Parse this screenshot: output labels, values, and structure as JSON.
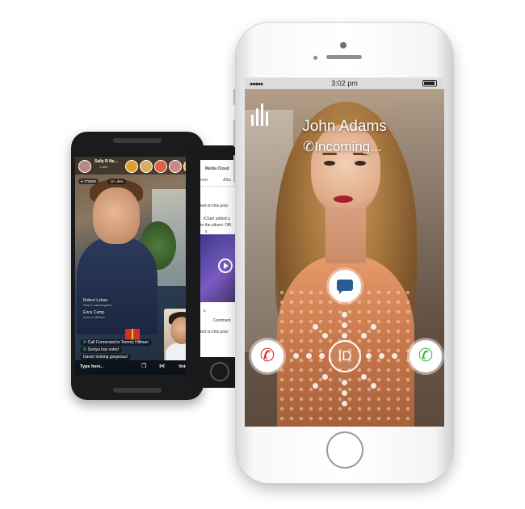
{
  "android": {
    "header_name": "Sally R Ne...",
    "header_sub": "1,080",
    "viewers": "778000",
    "badge": "12 Likes",
    "caption1_name": "Robert Leban",
    "caption1_sub": "Sent a Lamborghini",
    "caption2_name": "Erica Camp",
    "caption2_sub": "Sent a Gift Box",
    "chat1": "Call Connected to Tommy Hillman",
    "chat2": "Soniya has voted",
    "chat3": "David: looking gorgeous!",
    "input_placeholder": "Type here..",
    "vote_label": "Vote",
    "gift_icon": "gift-icon",
    "share_icon": "share-icon"
  },
  "mid_phone": {
    "tab_title": "Media Cloud",
    "tab1": "over",
    "tab2": "Albu",
    "line1": "ted on this post",
    "line2": "iChart added a",
    "line3": "to the album: Offi",
    "line4": "s",
    "reaction": "s",
    "comment": "Comment",
    "line5": "ted on this post"
  },
  "iphone": {
    "time": "3:02 pm",
    "caller_name": "John Adams",
    "call_status": "Incoming...",
    "id_label": "ID",
    "colors": {
      "decline": "#d9262f",
      "accept": "#3bb54a",
      "message": "#2a5d8f"
    }
  }
}
